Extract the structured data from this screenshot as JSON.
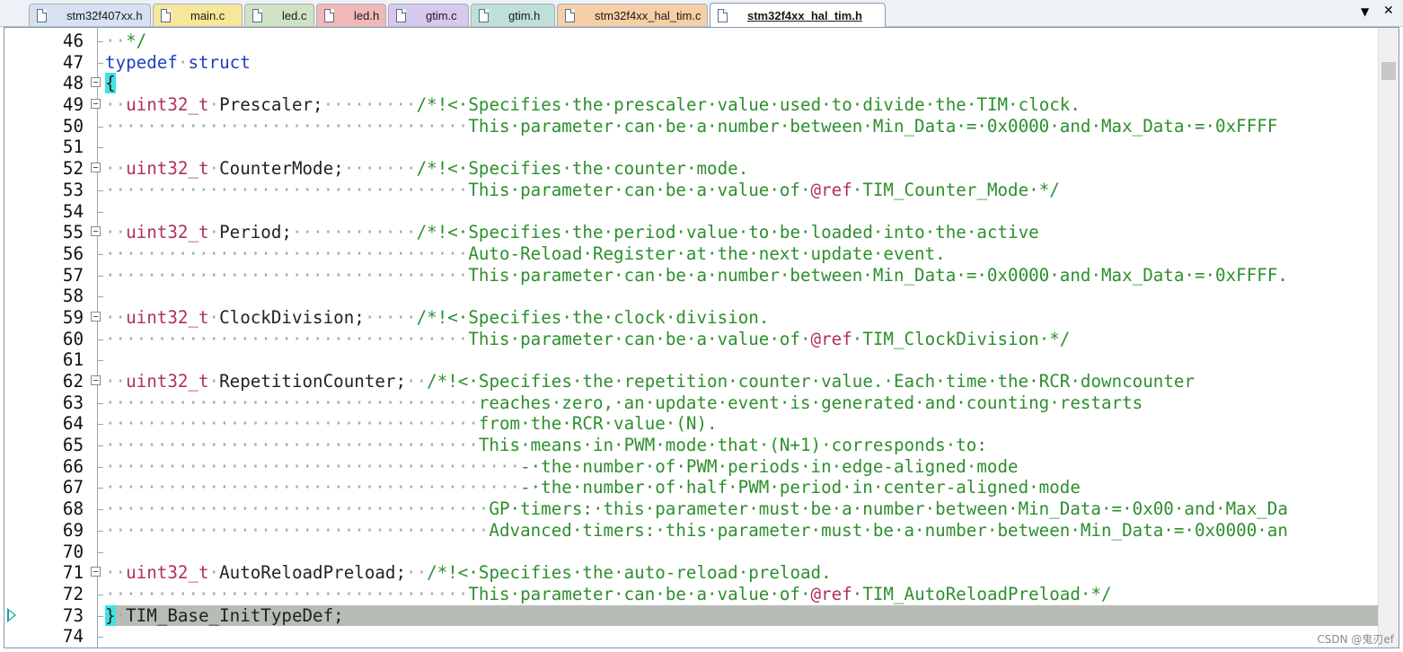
{
  "tabs": [
    {
      "label": "stm32f407xx.h",
      "color": "#d7e1f2"
    },
    {
      "label": "main.c",
      "color": "#f6e79a"
    },
    {
      "label": "led.c",
      "color": "#cfe3c4"
    },
    {
      "label": "led.h",
      "color": "#f2b8b8"
    },
    {
      "label": "gtim.c",
      "color": "#d7c8ee"
    },
    {
      "label": "gtim.h",
      "color": "#bfe0d6"
    },
    {
      "label": "stm32f4xx_hal_tim.c",
      "color": "#f6cfa6"
    },
    {
      "label": "stm32f4xx_hal_tim.h",
      "color": "#ffffff",
      "active": true
    }
  ],
  "tab_dropdown_icon": "triangle-down",
  "tab_close_icon": "close-x",
  "lines": [
    {
      "n": "46",
      "segs": [
        [
          "dots",
          "··"
        ],
        [
          "cm",
          "*/"
        ]
      ]
    },
    {
      "n": "47",
      "segs": [
        [
          "kw",
          "typedef"
        ],
        [
          "dots",
          "·"
        ],
        [
          "kw",
          "struct"
        ]
      ]
    },
    {
      "n": "48",
      "fold": true,
      "segs": [
        [
          "brace",
          "{"
        ]
      ]
    },
    {
      "n": "49",
      "fold": true,
      "segs": [
        [
          "dots",
          "··"
        ],
        [
          "ty",
          "uint32_t"
        ],
        [
          "dots",
          "·"
        ],
        [
          "id",
          "Prescaler;"
        ],
        [
          "dots",
          "·········"
        ],
        [
          "cm",
          "/*!<·Specifies·the·prescaler·value·used·to·divide·the·TIM·clock."
        ]
      ]
    },
    {
      "n": "50",
      "segs": [
        [
          "dots",
          "···································"
        ],
        [
          "cm",
          "This·parameter·can·be·a·number·between·Min_Data·=·0x0000·and·Max_Data·=·0xFFFF"
        ]
      ]
    },
    {
      "n": "51",
      "segs": []
    },
    {
      "n": "52",
      "fold": true,
      "segs": [
        [
          "dots",
          "··"
        ],
        [
          "ty",
          "uint32_t"
        ],
        [
          "dots",
          "·"
        ],
        [
          "id",
          "CounterMode;"
        ],
        [
          "dots",
          "·······"
        ],
        [
          "cm",
          "/*!<·Specifies·the·counter·mode."
        ]
      ]
    },
    {
      "n": "53",
      "segs": [
        [
          "dots",
          "···································"
        ],
        [
          "cm",
          "This·parameter·can·be·a·value·of·"
        ],
        [
          "ty",
          "@ref"
        ],
        [
          "cm",
          "·TIM_Counter_Mode·*/"
        ]
      ]
    },
    {
      "n": "54",
      "segs": []
    },
    {
      "n": "55",
      "fold": true,
      "segs": [
        [
          "dots",
          "··"
        ],
        [
          "ty",
          "uint32_t"
        ],
        [
          "dots",
          "·"
        ],
        [
          "id",
          "Period;"
        ],
        [
          "dots",
          "············"
        ],
        [
          "cm",
          "/*!<·Specifies·the·period·value·to·be·loaded·into·the·active"
        ]
      ]
    },
    {
      "n": "56",
      "segs": [
        [
          "dots",
          "···································"
        ],
        [
          "cm",
          "Auto-Reload·Register·at·the·next·update·event."
        ]
      ]
    },
    {
      "n": "57",
      "segs": [
        [
          "dots",
          "···································"
        ],
        [
          "cm",
          "This·parameter·can·be·a·number·between·Min_Data·=·0x0000·and·Max_Data·=·0xFFFF."
        ]
      ]
    },
    {
      "n": "58",
      "segs": []
    },
    {
      "n": "59",
      "fold": true,
      "segs": [
        [
          "dots",
          "··"
        ],
        [
          "ty",
          "uint32_t"
        ],
        [
          "dots",
          "·"
        ],
        [
          "id",
          "ClockDivision;"
        ],
        [
          "dots",
          "·····"
        ],
        [
          "cm",
          "/*!<·Specifies·the·clock·division."
        ]
      ]
    },
    {
      "n": "60",
      "segs": [
        [
          "dots",
          "···································"
        ],
        [
          "cm",
          "This·parameter·can·be·a·value·of·"
        ],
        [
          "ty",
          "@ref"
        ],
        [
          "cm",
          "·TIM_ClockDivision·*/"
        ]
      ]
    },
    {
      "n": "61",
      "segs": []
    },
    {
      "n": "62",
      "fold": true,
      "segs": [
        [
          "dots",
          "··"
        ],
        [
          "ty",
          "uint32_t"
        ],
        [
          "dots",
          "·"
        ],
        [
          "id",
          "RepetitionCounter;"
        ],
        [
          "dots",
          "··"
        ],
        [
          "cm",
          "/*!<·Specifies·the·repetition·counter·value.·Each·time·the·RCR·downcounter"
        ]
      ]
    },
    {
      "n": "63",
      "segs": [
        [
          "dots",
          "····································"
        ],
        [
          "cm",
          "reaches·zero,·an·update·event·is·generated·and·counting·restarts"
        ]
      ]
    },
    {
      "n": "64",
      "segs": [
        [
          "dots",
          "····································"
        ],
        [
          "cm",
          "from·the·RCR·value·(N)."
        ]
      ]
    },
    {
      "n": "65",
      "segs": [
        [
          "dots",
          "····································"
        ],
        [
          "cm",
          "This·means·in·PWM·mode·that·(N+1)·corresponds·to:"
        ]
      ]
    },
    {
      "n": "66",
      "segs": [
        [
          "dots",
          "········································"
        ],
        [
          "cm",
          "-·the·number·of·PWM·periods·in·edge-aligned·mode"
        ]
      ]
    },
    {
      "n": "67",
      "segs": [
        [
          "dots",
          "········································"
        ],
        [
          "cm",
          "-·the·number·of·half·PWM·period·in·center-aligned·mode"
        ]
      ]
    },
    {
      "n": "68",
      "segs": [
        [
          "dots",
          "·····································"
        ],
        [
          "cm",
          "GP·timers:·this·parameter·must·be·a·number·between·Min_Data·=·0x00·and·Max_Da"
        ]
      ]
    },
    {
      "n": "69",
      "segs": [
        [
          "dots",
          "·····································"
        ],
        [
          "cm",
          "Advanced·timers:·this·parameter·must·be·a·number·between·Min_Data·=·0x0000·an"
        ]
      ]
    },
    {
      "n": "70",
      "segs": []
    },
    {
      "n": "71",
      "fold": true,
      "segs": [
        [
          "dots",
          "··"
        ],
        [
          "ty",
          "uint32_t"
        ],
        [
          "dots",
          "·"
        ],
        [
          "id",
          "AutoReloadPreload;"
        ],
        [
          "dots",
          "··"
        ],
        [
          "cm",
          "/*!<·Specifies·the·auto-reload·preload."
        ]
      ]
    },
    {
      "n": "72",
      "segs": [
        [
          "dots",
          "···································"
        ],
        [
          "cm",
          "This·parameter·can·be·a·value·of·"
        ],
        [
          "ty",
          "@ref"
        ],
        [
          "cm",
          "·TIM_AutoReloadPreload·*/"
        ]
      ]
    },
    {
      "n": "73",
      "current": true,
      "segs": [
        [
          "brace",
          "}"
        ],
        [
          "dots",
          "·"
        ],
        [
          "id",
          "TIM_Base_InitTypeDef;"
        ]
      ]
    },
    {
      "n": "74",
      "segs": []
    }
  ],
  "watermark": "CSDN @鬼刃ef"
}
